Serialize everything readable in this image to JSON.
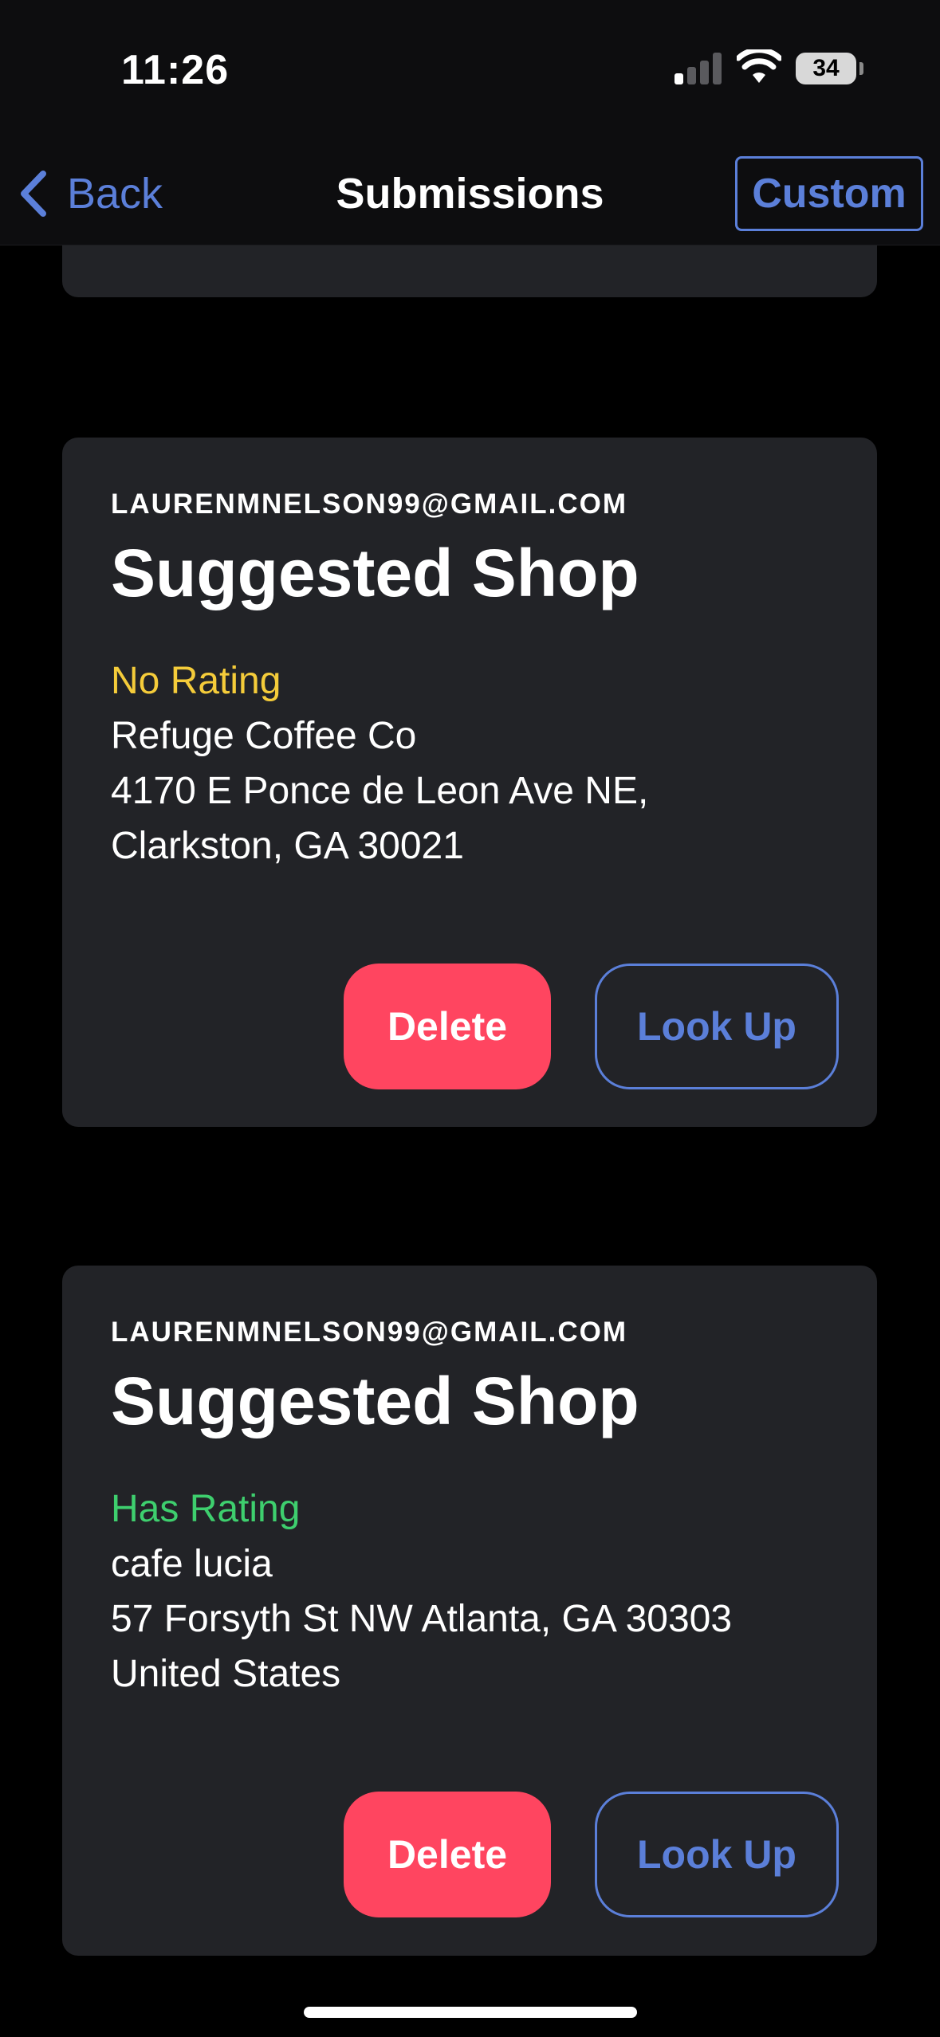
{
  "status_bar": {
    "time": "11:26",
    "battery": "34"
  },
  "nav": {
    "back_label": "Back",
    "title": "Submissions",
    "custom_label": "Custom"
  },
  "cards": [
    {
      "email": "LAURENMNELSON99@GMAIL.COM",
      "title": "Suggested Shop",
      "rating": "No Rating",
      "rating_color": "#f5cc3a",
      "lines": [
        "Refuge Coffee Co",
        "4170 E Ponce de Leon Ave NE,",
        "Clarkston, GA 30021"
      ],
      "delete_label": "Delete",
      "lookup_label": "Look Up"
    },
    {
      "email": "LAURENMNELSON99@GMAIL.COM",
      "title": "Suggested Shop",
      "rating": "Has Rating",
      "rating_color": "#3ecf6e",
      "lines": [
        "cafe lucia",
        "57 Forsyth St NW Atlanta, GA 30303",
        "United States"
      ],
      "delete_label": "Delete",
      "lookup_label": "Look Up"
    }
  ],
  "colors": {
    "accent": "#5b7fd9",
    "delete": "#ff4560",
    "card_bg": "#222327",
    "background": "#000000"
  },
  "icons": {
    "back": "chevron-left-icon",
    "signal": "cellular-signal-icon",
    "wifi": "wifi-icon",
    "battery": "battery-icon"
  }
}
